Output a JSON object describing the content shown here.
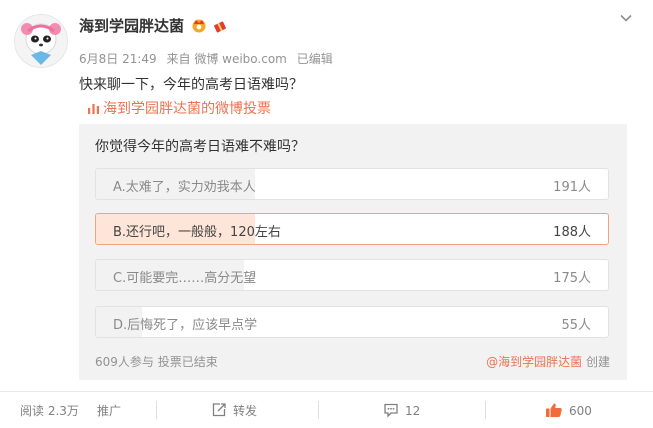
{
  "post": {
    "author": "海到学园胖达菌",
    "date": "6月8日 21:49",
    "source": "来自 微博 weibo.com",
    "edited": "已编辑",
    "text": "快来聊一下，今年的高考日语难吗？"
  },
  "poll_link": "海到学园胖达菌的微博投票",
  "poll": {
    "question": "你觉得今年的高考日语难不难吗？",
    "options": [
      {
        "label": "A.太难了，实力劝我本人",
        "count": "191人",
        "fraction": 0.31,
        "selected": false
      },
      {
        "label": "B.还行吧，一般般，120左右",
        "count": "188人",
        "fraction": 0.31,
        "selected": true
      },
      {
        "label": "C.可能要完……高分无望",
        "count": "175人",
        "fraction": 0.29,
        "selected": false
      },
      {
        "label": "D.后悔死了，应该早点学",
        "count": "55人",
        "fraction": 0.09,
        "selected": false
      }
    ],
    "footer_stats": "609人参与 投票已结束",
    "creator": "@海到学园胖达菌",
    "created": "创建"
  },
  "actions": {
    "read": "阅读 2.3万",
    "promote": "推广",
    "repost": "转发",
    "comment": "12",
    "like": "600"
  },
  "colors": {
    "accent": "#eb7350",
    "selected_fill": "#fde6d9",
    "selected_border": "#f2a47f",
    "card_bg": "#f2f2f2"
  },
  "icons": {
    "poll_link": "bar-chart-icon",
    "repost": "repost-icon",
    "comment": "comment-icon",
    "like": "thumbs-up-icon",
    "menu": "chevron-down-icon"
  }
}
